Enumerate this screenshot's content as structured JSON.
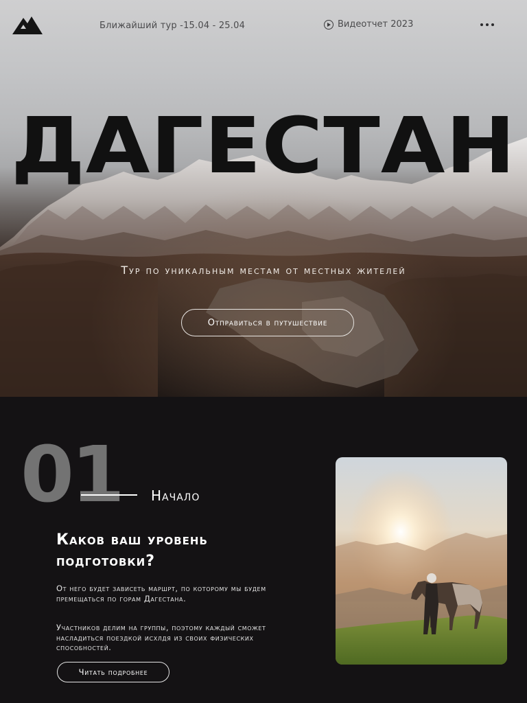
{
  "header": {
    "logo_icon": "mountain-logo-icon",
    "nearest_tour": "Ближайший тур -15.04 - 25.04",
    "video_report": "Видеотчет 2023",
    "video_icon": "play-circle-icon",
    "menu_icon": "more-dots-icon"
  },
  "hero": {
    "title": "ДАГЕСТАН",
    "subtitle": "Тур по уникальным местам от местных жителей",
    "cta": "Отправиться в путушествие"
  },
  "step": {
    "number": "01",
    "label": "Начало",
    "heading": "Каков ваш уровень подготовки?",
    "paragraph_1": "От него будет зависеть маршрт, по которому мы будем премещаться по горам Дагестана.",
    "paragraph_2": "Участников делим на группы, поэтому каждый сможет насладиться поездкой исхлдя из своих физических способностей.",
    "read_more": "Читать подробнее"
  },
  "colors": {
    "background_dark": "#141214",
    "step_number": "#737373",
    "title": "#111111"
  }
}
